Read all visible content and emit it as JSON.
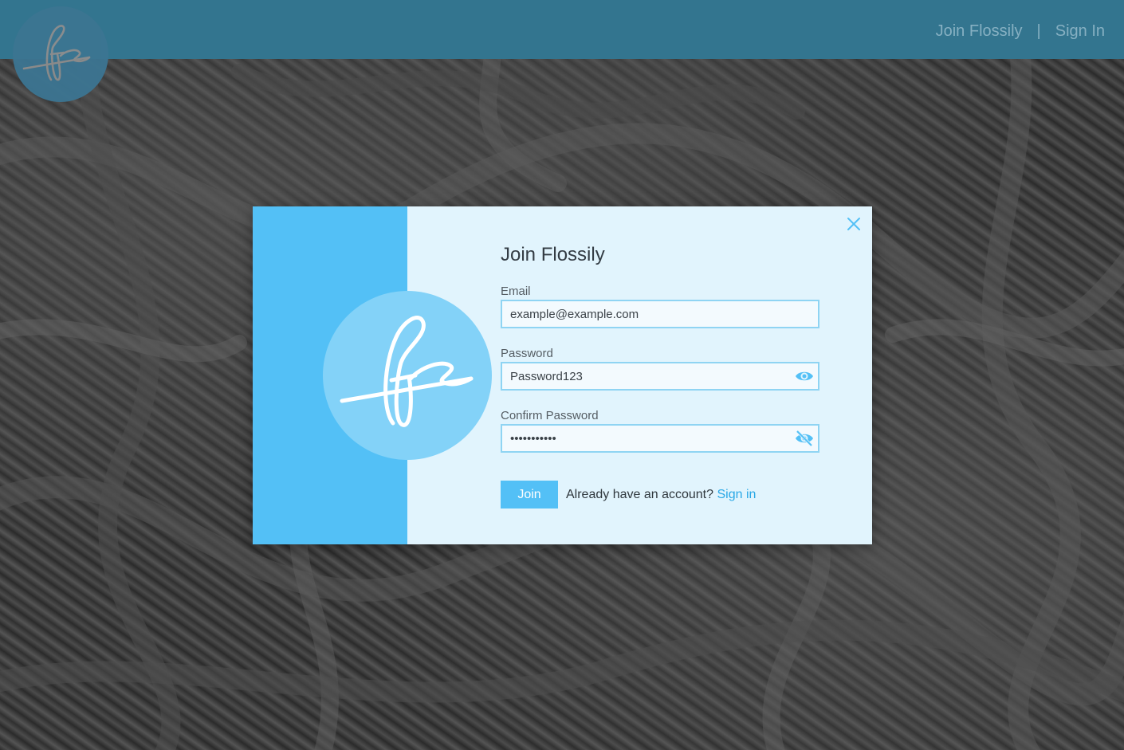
{
  "app": {
    "brand_logo_icon": "flossily-signature-needle-logo"
  },
  "topnav": {
    "join_label": "Join Flossily",
    "separator": "|",
    "signin_label": "Sign In"
  },
  "modal": {
    "title": "Join Flossily",
    "close_icon": "close-icon",
    "email": {
      "label": "Email",
      "value": "example@example.com"
    },
    "password": {
      "label": "Password",
      "value": "Password123",
      "visibility_icon": "eye-icon"
    },
    "confirm_password": {
      "label": "Confirm Password",
      "value": "Password123",
      "visibility_icon": "eye-off-icon"
    },
    "join_button": "Join",
    "account_prompt": "Already have an account?",
    "signin_link": "Sign in"
  },
  "colors": {
    "topbar": "#33758f",
    "modal_side": "#53c0f6",
    "modal_bg": "#e1f4fd",
    "accent": "#53c0f6",
    "link": "#2aa8e6"
  }
}
